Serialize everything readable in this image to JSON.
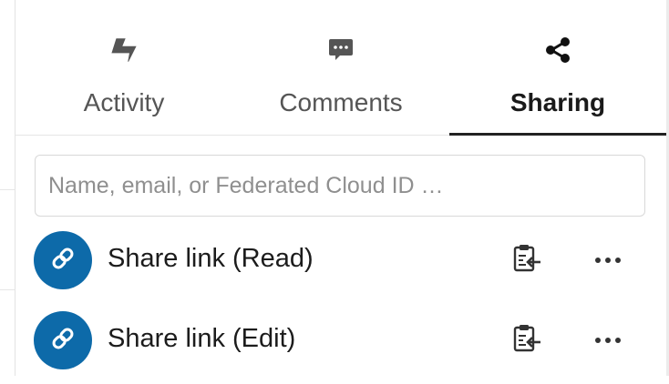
{
  "tabs": [
    {
      "label": "Activity",
      "icon": "activity-icon",
      "active": false
    },
    {
      "label": "Comments",
      "icon": "comment-icon",
      "active": false
    },
    {
      "label": "Sharing",
      "icon": "share-icon",
      "active": true
    }
  ],
  "search": {
    "placeholder": "Name, email, or Federated Cloud ID …",
    "value": ""
  },
  "share_links": [
    {
      "label": "Share link (Read)",
      "avatar_icon": "link-icon",
      "copy_icon": "clipboard-icon",
      "menu_icon": "more-icon"
    },
    {
      "label": "Share link (Edit)",
      "avatar_icon": "link-icon",
      "copy_icon": "clipboard-icon",
      "menu_icon": "more-icon"
    }
  ],
  "colors": {
    "accent": "#0d6aa9",
    "active_tab_underline": "#222222",
    "text": "#1c1c1c",
    "muted": "#555555"
  }
}
